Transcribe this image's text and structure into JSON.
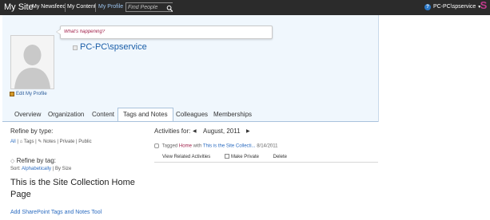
{
  "topbar": {
    "site_title": "My Site",
    "nav": [
      "My Newsfeed",
      "My Content",
      "My Profile"
    ],
    "active_nav": "My Profile",
    "search_placeholder": "Find People",
    "user_name": "PC-PC\\spservice",
    "colors": {
      "bar": "#2b2b2b",
      "active_link": "#9dc4ee"
    }
  },
  "profile": {
    "status_placeholder": "What's happening?",
    "name": "PC-PC\\spservice",
    "edit_profile_label": "Edit My Profile"
  },
  "tabs": [
    {
      "label": "Overview"
    },
    {
      "label": "Organization"
    },
    {
      "label": "Content"
    },
    {
      "label": "Tags and Notes",
      "active": true
    },
    {
      "label": "Colleagues"
    },
    {
      "label": "Memberships"
    }
  ],
  "refine": {
    "type_heading": "Refine by type:",
    "type_all": "All",
    "type_tags": "Tags",
    "type_notes": "Notes",
    "type_private": "Private",
    "type_public": "Public",
    "tag_heading": "Refine by tag:",
    "sort_label": "Sort:",
    "sort_alpha": "Alphabetically",
    "sort_size": "By Size",
    "tag_item": "This is the Site Collection Home Page",
    "add_tool": "Add SharePoint Tags and Notes Tool"
  },
  "activities": {
    "label": "Activities for:",
    "month": "August, 2011",
    "item": {
      "prefix": "Tagged",
      "tag": "Home",
      "with": "with",
      "target": "This is the Site Collecti...",
      "date": "8/14/2011"
    },
    "actions": {
      "view_related": "View Related Activities",
      "make_private": "Make Private",
      "delete": "Delete"
    }
  }
}
